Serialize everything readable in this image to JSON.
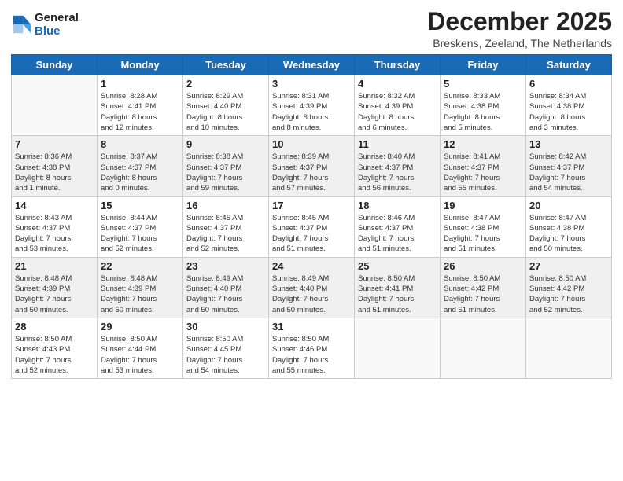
{
  "logo": {
    "line1": "General",
    "line2": "Blue"
  },
  "title": "December 2025",
  "subtitle": "Breskens, Zeeland, The Netherlands",
  "weekdays": [
    "Sunday",
    "Monday",
    "Tuesday",
    "Wednesday",
    "Thursday",
    "Friday",
    "Saturday"
  ],
  "weeks": [
    [
      {
        "day": "",
        "info": ""
      },
      {
        "day": "1",
        "info": "Sunrise: 8:28 AM\nSunset: 4:41 PM\nDaylight: 8 hours\nand 12 minutes."
      },
      {
        "day": "2",
        "info": "Sunrise: 8:29 AM\nSunset: 4:40 PM\nDaylight: 8 hours\nand 10 minutes."
      },
      {
        "day": "3",
        "info": "Sunrise: 8:31 AM\nSunset: 4:39 PM\nDaylight: 8 hours\nand 8 minutes."
      },
      {
        "day": "4",
        "info": "Sunrise: 8:32 AM\nSunset: 4:39 PM\nDaylight: 8 hours\nand 6 minutes."
      },
      {
        "day": "5",
        "info": "Sunrise: 8:33 AM\nSunset: 4:38 PM\nDaylight: 8 hours\nand 5 minutes."
      },
      {
        "day": "6",
        "info": "Sunrise: 8:34 AM\nSunset: 4:38 PM\nDaylight: 8 hours\nand 3 minutes."
      }
    ],
    [
      {
        "day": "7",
        "info": "Sunrise: 8:36 AM\nSunset: 4:38 PM\nDaylight: 8 hours\nand 1 minute."
      },
      {
        "day": "8",
        "info": "Sunrise: 8:37 AM\nSunset: 4:37 PM\nDaylight: 8 hours\nand 0 minutes."
      },
      {
        "day": "9",
        "info": "Sunrise: 8:38 AM\nSunset: 4:37 PM\nDaylight: 7 hours\nand 59 minutes."
      },
      {
        "day": "10",
        "info": "Sunrise: 8:39 AM\nSunset: 4:37 PM\nDaylight: 7 hours\nand 57 minutes."
      },
      {
        "day": "11",
        "info": "Sunrise: 8:40 AM\nSunset: 4:37 PM\nDaylight: 7 hours\nand 56 minutes."
      },
      {
        "day": "12",
        "info": "Sunrise: 8:41 AM\nSunset: 4:37 PM\nDaylight: 7 hours\nand 55 minutes."
      },
      {
        "day": "13",
        "info": "Sunrise: 8:42 AM\nSunset: 4:37 PM\nDaylight: 7 hours\nand 54 minutes."
      }
    ],
    [
      {
        "day": "14",
        "info": "Sunrise: 8:43 AM\nSunset: 4:37 PM\nDaylight: 7 hours\nand 53 minutes."
      },
      {
        "day": "15",
        "info": "Sunrise: 8:44 AM\nSunset: 4:37 PM\nDaylight: 7 hours\nand 52 minutes."
      },
      {
        "day": "16",
        "info": "Sunrise: 8:45 AM\nSunset: 4:37 PM\nDaylight: 7 hours\nand 52 minutes."
      },
      {
        "day": "17",
        "info": "Sunrise: 8:45 AM\nSunset: 4:37 PM\nDaylight: 7 hours\nand 51 minutes."
      },
      {
        "day": "18",
        "info": "Sunrise: 8:46 AM\nSunset: 4:37 PM\nDaylight: 7 hours\nand 51 minutes."
      },
      {
        "day": "19",
        "info": "Sunrise: 8:47 AM\nSunset: 4:38 PM\nDaylight: 7 hours\nand 51 minutes."
      },
      {
        "day": "20",
        "info": "Sunrise: 8:47 AM\nSunset: 4:38 PM\nDaylight: 7 hours\nand 50 minutes."
      }
    ],
    [
      {
        "day": "21",
        "info": "Sunrise: 8:48 AM\nSunset: 4:39 PM\nDaylight: 7 hours\nand 50 minutes."
      },
      {
        "day": "22",
        "info": "Sunrise: 8:48 AM\nSunset: 4:39 PM\nDaylight: 7 hours\nand 50 minutes."
      },
      {
        "day": "23",
        "info": "Sunrise: 8:49 AM\nSunset: 4:40 PM\nDaylight: 7 hours\nand 50 minutes."
      },
      {
        "day": "24",
        "info": "Sunrise: 8:49 AM\nSunset: 4:40 PM\nDaylight: 7 hours\nand 50 minutes."
      },
      {
        "day": "25",
        "info": "Sunrise: 8:50 AM\nSunset: 4:41 PM\nDaylight: 7 hours\nand 51 minutes."
      },
      {
        "day": "26",
        "info": "Sunrise: 8:50 AM\nSunset: 4:42 PM\nDaylight: 7 hours\nand 51 minutes."
      },
      {
        "day": "27",
        "info": "Sunrise: 8:50 AM\nSunset: 4:42 PM\nDaylight: 7 hours\nand 52 minutes."
      }
    ],
    [
      {
        "day": "28",
        "info": "Sunrise: 8:50 AM\nSunset: 4:43 PM\nDaylight: 7 hours\nand 52 minutes."
      },
      {
        "day": "29",
        "info": "Sunrise: 8:50 AM\nSunset: 4:44 PM\nDaylight: 7 hours\nand 53 minutes."
      },
      {
        "day": "30",
        "info": "Sunrise: 8:50 AM\nSunset: 4:45 PM\nDaylight: 7 hours\nand 54 minutes."
      },
      {
        "day": "31",
        "info": "Sunrise: 8:50 AM\nSunset: 4:46 PM\nDaylight: 7 hours\nand 55 minutes."
      },
      {
        "day": "",
        "info": ""
      },
      {
        "day": "",
        "info": ""
      },
      {
        "day": "",
        "info": ""
      }
    ]
  ]
}
